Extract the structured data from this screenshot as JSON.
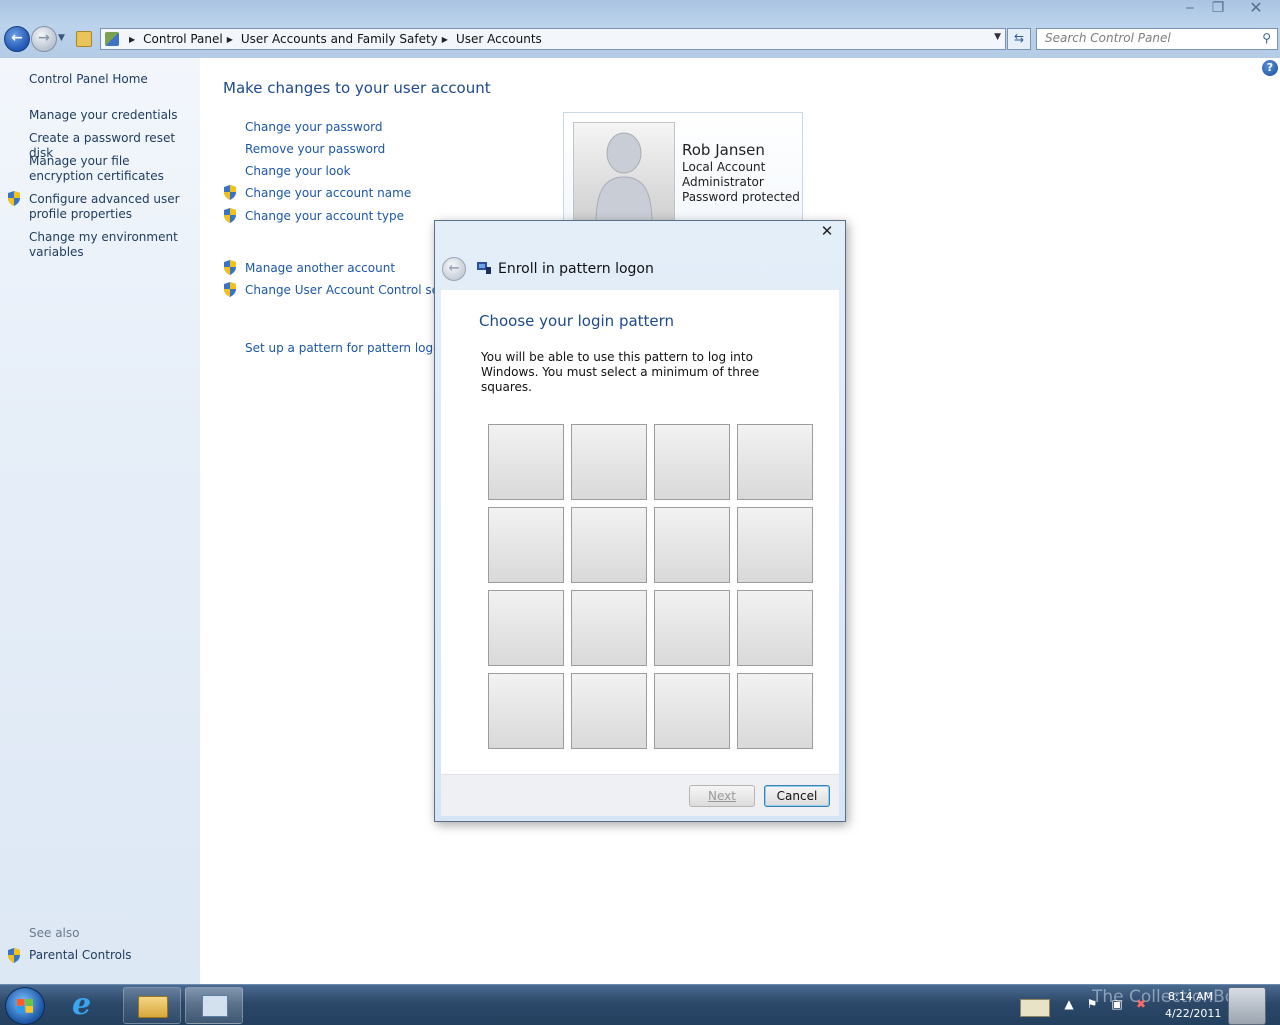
{
  "window": {
    "title": "",
    "caption_buttons": {
      "minimize": "‒",
      "maximize": "❐",
      "close": "✕"
    }
  },
  "address_bar": {
    "breadcrumbs": [
      "Control Panel",
      "User Accounts and Family Safety",
      "User Accounts"
    ]
  },
  "search": {
    "placeholder": "Search Control Panel"
  },
  "sidebar": {
    "home": "Control Panel Home",
    "links": [
      "Manage your credentials",
      "Create a password reset disk",
      "Manage your file encryption certificates",
      "Configure advanced user profile properties",
      "Change my environment variables"
    ],
    "see_also_label": "See also",
    "see_also_links": [
      "Parental Controls"
    ]
  },
  "main": {
    "title": "Make changes to your user account",
    "tasks": [
      "Change your password",
      "Remove your password",
      "Change your look",
      "Change your account name",
      "Change your account type"
    ],
    "other_tasks": [
      "Manage another account",
      "Change User Account Control settin"
    ],
    "pattern_link": "Set up a pattern for pattern logon"
  },
  "account": {
    "name": "Rob Jansen",
    "type": "Local Account",
    "role": "Administrator",
    "status": "Password protected"
  },
  "dialog": {
    "title": "Enroll in pattern logon",
    "close_glyph": "✕",
    "heading": "Choose your login pattern",
    "description": "You will be able to use this pattern to log into Windows. You must select a minimum of three squares.",
    "grid_rows": 4,
    "grid_cols": 4,
    "next_label": "Next",
    "cancel_label": "Cancel"
  },
  "taskbar": {
    "time": "8:14 AM",
    "date": "4/22/2011",
    "watermark": "The CollectionBook"
  },
  "colors": {
    "link": "#1c57a8",
    "heading": "#1e4a8c",
    "sidebar_bg": "#e6eef8",
    "taskbar_bg": "#2c4869"
  }
}
